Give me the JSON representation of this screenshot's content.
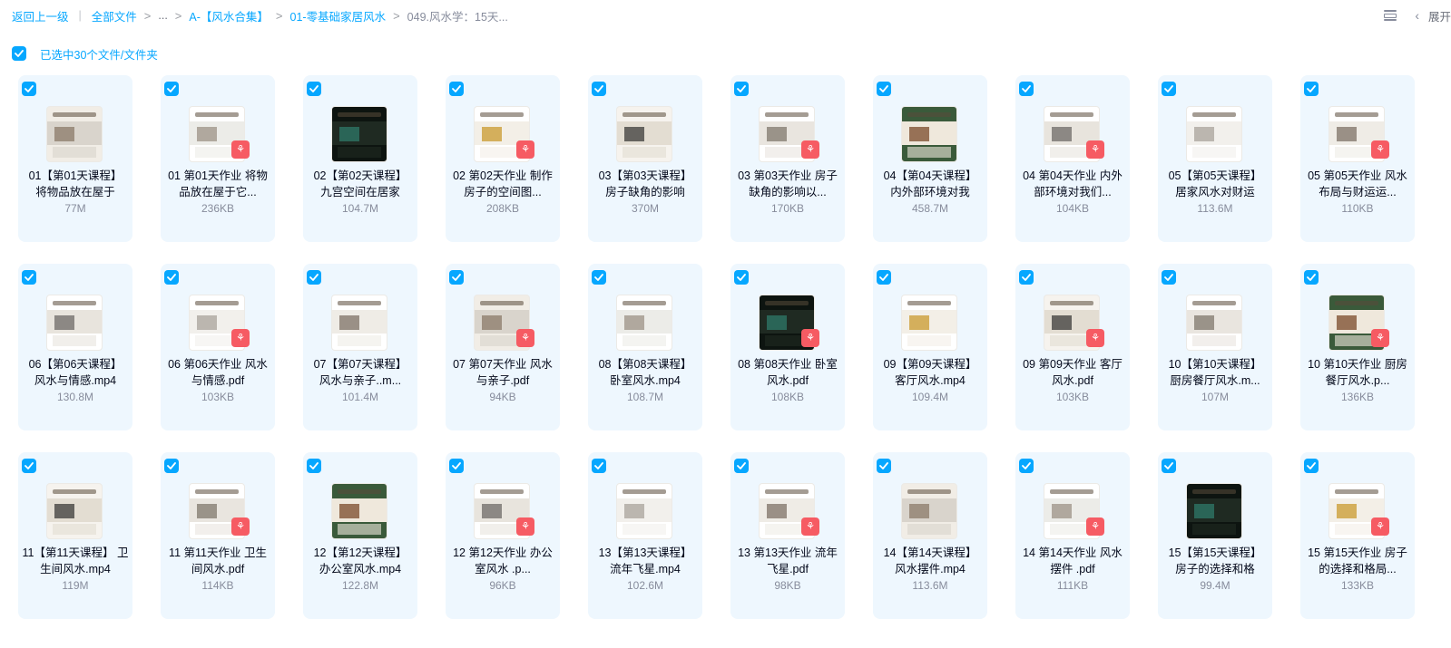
{
  "breadcrumb": {
    "back": "返回上一级",
    "all_files": "全部文件",
    "ellipsis": "...",
    "level1": "A-【风水合集】",
    "level2": "01-零基础家居风水",
    "current": "049.风水学：15天..."
  },
  "toolbar": {
    "expand_label": "展开",
    "list_view_icon": "list-view-icon",
    "collapse_icon": "chevron-left-icon"
  },
  "selection": {
    "label": "已选中30个文件/文件夹",
    "checked": true
  },
  "colors": {
    "accent": "#06a7ff",
    "card_bg": "#eef7fe",
    "pdf_badge": "#f65b63",
    "muted_text": "#878c9c"
  },
  "files": [
    {
      "name": "01【第01天课程】 将物品放在屋于",
      "size": "77M",
      "type": "video",
      "checked": true
    },
    {
      "name": "01 第01天作业 将物品放在屋于它...",
      "size": "236KB",
      "type": "pdf",
      "checked": true
    },
    {
      "name": "02【第02天课程】 九宫空间在居家",
      "size": "104.7M",
      "type": "video",
      "checked": true
    },
    {
      "name": "02 第02天作业 制作房子的空间图...",
      "size": "208KB",
      "type": "pdf",
      "checked": true
    },
    {
      "name": "03【第03天课程】 房子缺角的影响",
      "size": "370M",
      "type": "video",
      "checked": true
    },
    {
      "name": "03 第03天作业 房子缺角的影响以...",
      "size": "170KB",
      "type": "pdf",
      "checked": true
    },
    {
      "name": "04【第04天课程】 内外部环境对我",
      "size": "458.7M",
      "type": "video",
      "checked": true
    },
    {
      "name": "04 第04天作业 内外部环境对我们...",
      "size": "104KB",
      "type": "pdf",
      "checked": true
    },
    {
      "name": "05【第05天课程】 居家风水对财运",
      "size": "113.6M",
      "type": "video",
      "checked": true
    },
    {
      "name": "05 第05天作业 风水布局与财运运...",
      "size": "110KB",
      "type": "pdf",
      "checked": true
    },
    {
      "name": "06【第06天课程】 风水与情感.mp4",
      "size": "130.8M",
      "type": "video",
      "checked": true
    },
    {
      "name": "06 第06天作业 风水与情感.pdf",
      "size": "103KB",
      "type": "pdf",
      "checked": true
    },
    {
      "name": "07【第07天课程】 风水与亲子..m...",
      "size": "101.4M",
      "type": "video",
      "checked": true
    },
    {
      "name": "07 第07天作业 风水与亲子.pdf",
      "size": "94KB",
      "type": "pdf",
      "checked": true
    },
    {
      "name": "08【第08天课程】 卧室风水.mp4",
      "size": "108.7M",
      "type": "video",
      "checked": true
    },
    {
      "name": "08 第08天作业 卧室风水.pdf",
      "size": "108KB",
      "type": "pdf",
      "checked": true
    },
    {
      "name": "09【第09天课程】 客厅风水.mp4",
      "size": "109.4M",
      "type": "video",
      "checked": true
    },
    {
      "name": "09 第09天作业 客厅风水.pdf",
      "size": "103KB",
      "type": "pdf",
      "checked": true
    },
    {
      "name": "10【第10天课程】 厨房餐厅风水.m...",
      "size": "107M",
      "type": "video",
      "checked": true
    },
    {
      "name": "10 第10天作业 厨房餐厅风水.p...",
      "size": "136KB",
      "type": "pdf",
      "checked": true
    },
    {
      "name": "11【第11天课程】 卫生间风水.mp4",
      "size": "119M",
      "type": "video",
      "checked": true
    },
    {
      "name": "11 第11天作业 卫生间风水.pdf",
      "size": "114KB",
      "type": "pdf",
      "checked": true
    },
    {
      "name": "12【第12天课程】 办公室风水.mp4",
      "size": "122.8M",
      "type": "video",
      "checked": true
    },
    {
      "name": "12 第12天作业 办公室风水 .p...",
      "size": "96KB",
      "type": "pdf",
      "checked": true
    },
    {
      "name": "13【第13天课程】 流年飞星.mp4",
      "size": "102.6M",
      "type": "video",
      "checked": true
    },
    {
      "name": "13 第13天作业 流年飞星.pdf",
      "size": "98KB",
      "type": "pdf",
      "checked": true
    },
    {
      "name": "14【第14天课程】 风水摆件.mp4",
      "size": "113.6M",
      "type": "video",
      "checked": true
    },
    {
      "name": "14 第14天作业 风水摆件 .pdf",
      "size": "111KB",
      "type": "pdf",
      "checked": true
    },
    {
      "name": "15【第15天课程】 房子的选择和格",
      "size": "99.4M",
      "type": "video",
      "checked": true
    },
    {
      "name": "15 第15天作业 房子的选择和格局...",
      "size": "133KB",
      "type": "pdf",
      "checked": true
    }
  ]
}
